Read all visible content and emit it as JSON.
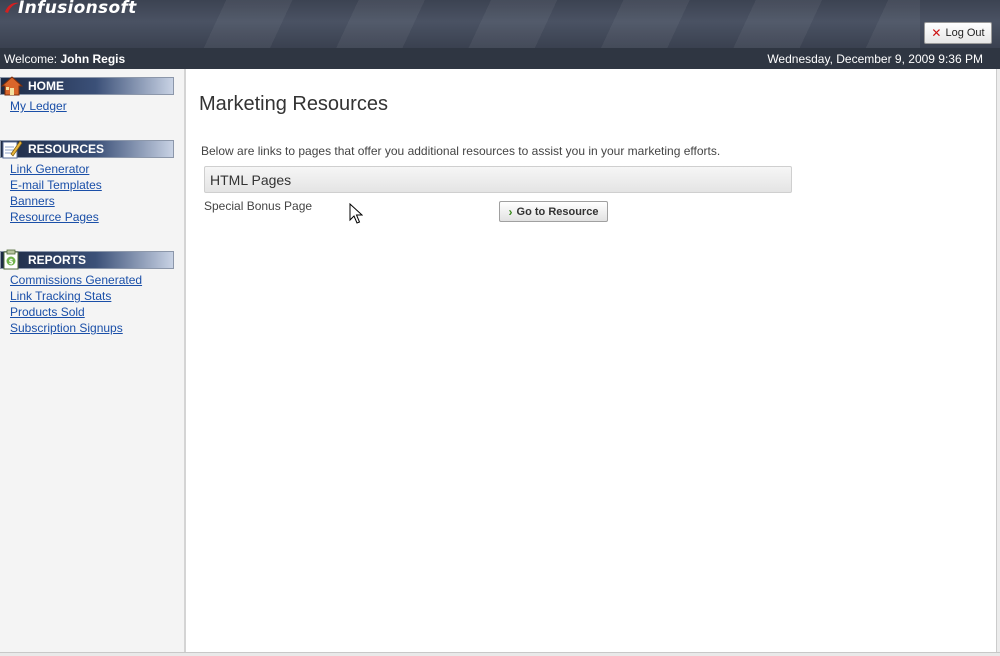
{
  "header": {
    "logo_text": "Infusionsoft",
    "logout_label": "Log Out"
  },
  "welcome": {
    "prefix": "Welcome:",
    "user_name": "John Regis",
    "datetime": "Wednesday, December 9, 2009 9:36 PM"
  },
  "sidebar": {
    "sections": [
      {
        "title": "HOME",
        "links": [
          "My Ledger"
        ]
      },
      {
        "title": "RESOURCES",
        "links": [
          "Link Generator",
          "E-mail Templates",
          "Banners",
          "Resource Pages"
        ]
      },
      {
        "title": "REPORTS",
        "links": [
          "Commissions Generated",
          "Link Tracking Stats",
          "Products Sold",
          "Subscription Signups"
        ]
      }
    ]
  },
  "main": {
    "title": "Marketing Resources",
    "intro": "Below are links to pages that offer you additional resources to assist you in your marketing efforts.",
    "group_title": "HTML Pages",
    "resources": [
      {
        "name": "Special Bonus Page",
        "button_label": "Go to Resource"
      }
    ]
  },
  "colors": {
    "header_bg": "#3c4352",
    "welcome_bg": "#2f3642",
    "link": "#1a4fa8",
    "section_head": "#1d2a44"
  }
}
